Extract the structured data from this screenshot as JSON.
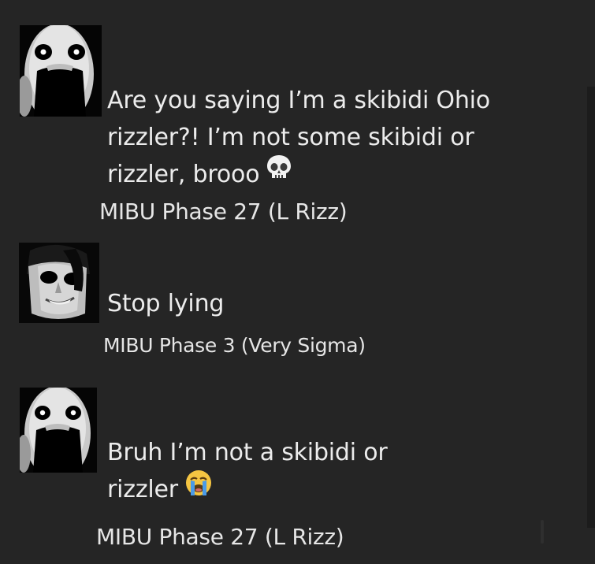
{
  "messages": [
    {
      "avatar_icon": "grimacing-face-avatar-icon",
      "lines": [
        "Are you saying I’m a skibidi Ohio",
        "rizzler?! I’m not some skibidi or",
        "rizzler, brooo"
      ],
      "trailing_emoji": "skull-emoji-icon",
      "author": "MIBU Phase 27 (L Rizz)"
    },
    {
      "avatar_icon": "smiling-man-avatar-icon",
      "lines": [
        "Stop lying"
      ],
      "author": "MIBU Phase 3 (Very Sigma)"
    },
    {
      "avatar_icon": "grimacing-face-avatar-icon",
      "lines": [
        "Bruh I’m not a skibidi or",
        "rizzler"
      ],
      "trailing_emoji": "crying-face-emoji-icon",
      "author": "MIBU Phase 27 (L Rizz)"
    }
  ],
  "colors": {
    "background": "#252525",
    "text": "#ececec",
    "emoji_yellow": "#f5c542",
    "emoji_blue": "#4a9be8"
  }
}
